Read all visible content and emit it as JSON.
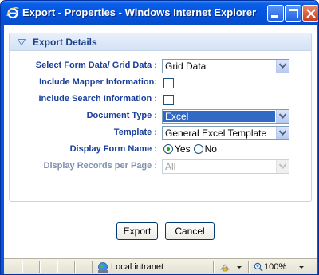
{
  "window": {
    "title": "Export - Properties - Windows Internet Explorer"
  },
  "panel": {
    "title": "Export Details"
  },
  "form": {
    "form_data": {
      "label": "Select Form Data/ Grid Data :",
      "value": "Grid Data"
    },
    "mapper": {
      "label": "Include Mapper Information:",
      "checked": false
    },
    "search": {
      "label": "Include Search Information :",
      "checked": false
    },
    "doc_type": {
      "label": "Document Type :",
      "value": "Excel"
    },
    "template": {
      "label": "Template :",
      "value": "General Excel Template"
    },
    "display_form_name": {
      "label": "Display Form Name :",
      "yes_label": "Yes",
      "no_label": "No",
      "selected": "Yes"
    },
    "records_per_page": {
      "label": "Display Records per Page :",
      "value": "All",
      "disabled": true
    }
  },
  "buttons": {
    "export_label": "Export",
    "cancel_label": "Cancel"
  },
  "statusbar": {
    "zone": "Local intranet",
    "zoom": "100%"
  },
  "colors": {
    "title_bar": "#0456e0",
    "label_blue": "#1a3e9a",
    "selection": "#316ac5"
  }
}
